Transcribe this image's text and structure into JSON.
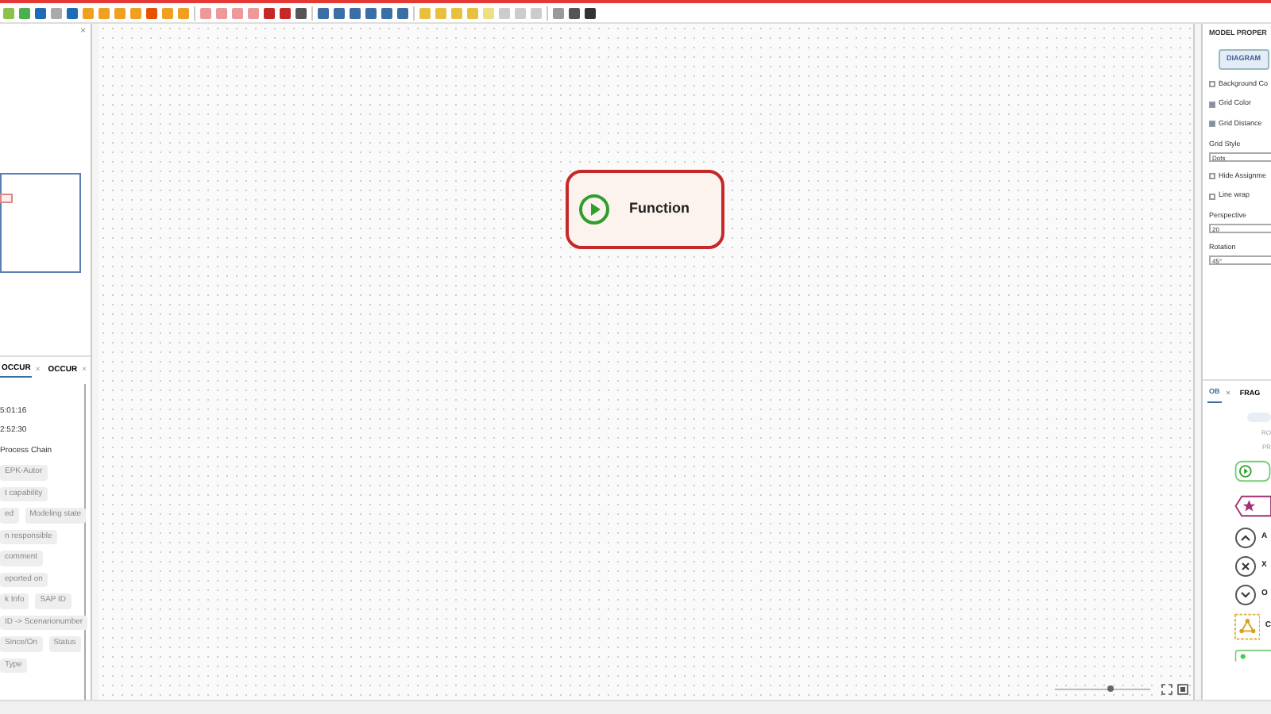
{
  "left_panel": {
    "minimap_close": "×",
    "tabs": [
      {
        "label": "OCCUR",
        "close": "×",
        "selected": true
      },
      {
        "label": "OCCUR",
        "close": "×",
        "selected": false
      }
    ],
    "info_lines": [
      "5:01:16",
      "2:52:30",
      "Process Chain"
    ],
    "attribute_rows": [
      [
        "EPK-Autor"
      ],
      [
        "t capability"
      ],
      [
        "ed",
        "Modeling state"
      ],
      [
        "n responsible"
      ],
      [
        "comment"
      ],
      [
        "eported on"
      ],
      [
        "k Info",
        "SAP ID"
      ],
      [
        "ID -> Scenarionumber"
      ],
      [
        "Since/On",
        "Status"
      ],
      [
        "Type"
      ]
    ]
  },
  "canvas": {
    "node": {
      "label": "Function"
    },
    "zoom": {
      "level": 0.55
    }
  },
  "right_panel": {
    "title": "MODEL PROPER",
    "section_button": "DIAGRAM",
    "options": [
      {
        "kind": "checkbox",
        "label": "Background Co",
        "checked": false
      },
      {
        "kind": "checkbox",
        "label": "Grid Color",
        "checked": true
      },
      {
        "kind": "checkbox",
        "label": "Grid Distance",
        "checked": true
      },
      {
        "kind": "select",
        "label": "Grid Style",
        "value": "Dots"
      },
      {
        "kind": "checkbox",
        "label": "Hide Assignme",
        "checked": false
      },
      {
        "kind": "checkbox",
        "label": "Line wrap",
        "checked": false
      },
      {
        "kind": "input",
        "label": "Perspective",
        "value": "20"
      },
      {
        "kind": "input",
        "label": "Rotation",
        "value": "45°"
      }
    ]
  },
  "palette": {
    "tabs": [
      {
        "label": "OB",
        "close": "×",
        "selected": true
      },
      {
        "label": "FRAG",
        "selected": false
      }
    ],
    "hint_lines": [
      "RO",
      "PR"
    ],
    "shapes": [
      {
        "kind": "function"
      },
      {
        "kind": "event"
      },
      {
        "kind": "and",
        "label": "A"
      },
      {
        "kind": "xor",
        "label": "X"
      },
      {
        "kind": "or",
        "label": "O"
      },
      {
        "kind": "org",
        "label": "C"
      },
      {
        "kind": "process"
      }
    ]
  }
}
